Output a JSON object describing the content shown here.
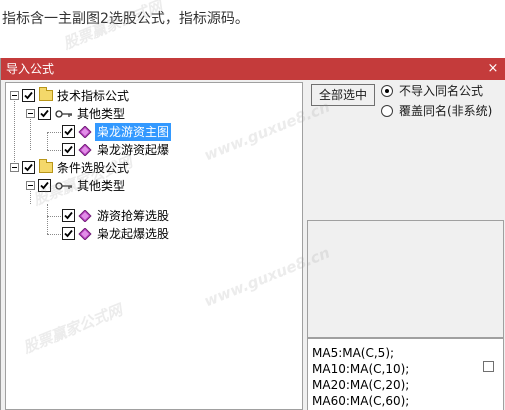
{
  "caption": "指标含一主副图2选股公式，指标源码。",
  "dialog": {
    "title": "导入公式",
    "close_glyph": "×",
    "tree": {
      "group1": "技术指标公式",
      "group1_sub": "其他类型",
      "group1_items": [
        "枭龙游资主图",
        "枭龙游资起爆"
      ],
      "group2": "条件选股公式",
      "group2_sub": "其他类型",
      "group2_items": [
        "游资抢筹选股",
        "枭龙起爆选股"
      ],
      "selected": "枭龙游资主图"
    },
    "select_all_button": "全部选中",
    "radio": {
      "option1": "不导入同名公式",
      "option2": "覆盖同名(非系统)",
      "selected": "option1"
    },
    "code_lines": [
      "MA5:MA(C,5);",
      "MA10:MA(C,10);",
      "MA20:MA(C,20);",
      "MA60:MA(C,60);"
    ]
  },
  "watermarks": [
    "股票赢家公式网",
    "www.guxue8.cn"
  ],
  "colors": {
    "titlebar": "#c43b3b",
    "selection": "#3399ff",
    "dialog_bg": "#f0f0f0"
  },
  "icons": {
    "folder": "folder-icon",
    "key": "key-icon",
    "formula": "formula-gem-icon"
  }
}
